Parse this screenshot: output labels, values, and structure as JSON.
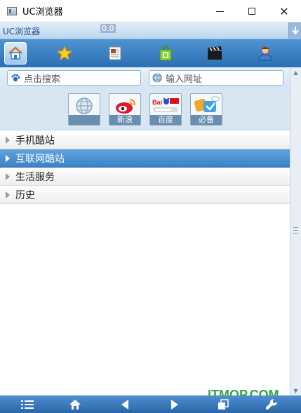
{
  "window": {
    "title": "UC浏览器",
    "close_symbol": "✕"
  },
  "subbar": {
    "title": "UC浏览器",
    "badge": "0.0",
    "menu_icon": "download-arrow-icon"
  },
  "nav_tabs": [
    {
      "id": "home",
      "icon": "home-icon",
      "active": true
    },
    {
      "id": "bookmarks",
      "icon": "star-icon",
      "active": false
    },
    {
      "id": "news",
      "icon": "news-icon",
      "active": false
    },
    {
      "id": "group-buy",
      "icon": "shopping-bag-icon",
      "active": false
    },
    {
      "id": "video",
      "icon": "clapperboard-icon",
      "active": false
    },
    {
      "id": "user",
      "icon": "user-icon",
      "active": false
    }
  ],
  "search": {
    "placeholder": "点击搜索",
    "url_placeholder": "输入网址"
  },
  "shortcuts": [
    {
      "label": "",
      "icon": "globe-icon"
    },
    {
      "label": "新浪",
      "icon": "sina-weibo-icon"
    },
    {
      "label": "百度",
      "icon": "baidu-icon"
    },
    {
      "label": "必备",
      "icon": "apps-icon"
    }
  ],
  "list_items": [
    {
      "label": "手机酷站",
      "selected": false
    },
    {
      "label": "互联网酷站",
      "selected": true
    },
    {
      "label": "生活服务",
      "selected": false
    },
    {
      "label": "历史",
      "selected": false
    }
  ],
  "watermark": "ITMOP.COM",
  "bottom_toolbar": [
    {
      "id": "menu",
      "icon": "menu-icon"
    },
    {
      "id": "home",
      "icon": "home-icon"
    },
    {
      "id": "back",
      "icon": "back-arrow-icon"
    },
    {
      "id": "forward",
      "icon": "forward-arrow-icon"
    },
    {
      "id": "windows",
      "icon": "windows-icon"
    },
    {
      "id": "tools",
      "icon": "wrench-icon"
    }
  ],
  "colors": {
    "accent": "#3a82c6",
    "navbar": "#2b6fb4",
    "watermark": "#3aa348"
  }
}
